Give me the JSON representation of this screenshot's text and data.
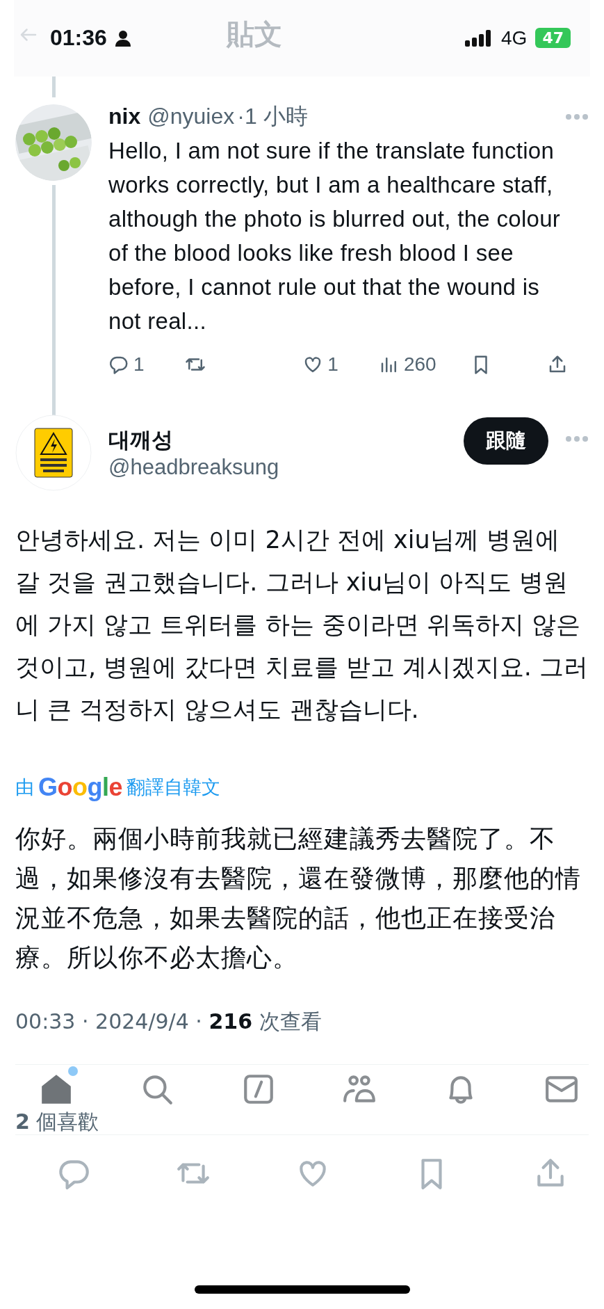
{
  "status_bar": {
    "time": "01:36",
    "network": "4G",
    "battery": "47"
  },
  "header": {
    "title": "貼文"
  },
  "reply": {
    "name": "nix",
    "handle": "@nyuiex",
    "time": "·1 小時",
    "text": "Hello, I am not sure if the translate function works correctly, but I am a healthcare staff, although the photo is blurred out, the colour of the blood looks like fresh blood I see before, I cannot rule out that the wound is not real...",
    "actions": [
      {
        "kind": "reply",
        "count": "1"
      },
      {
        "kind": "repost"
      },
      {
        "kind": "like",
        "count": "1"
      },
      {
        "kind": "views",
        "count": "260"
      },
      {
        "kind": "bookmark"
      },
      {
        "kind": "share"
      }
    ]
  },
  "tweet": {
    "name": "대깨성",
    "handle": "@headbreaksung",
    "follow_button": "跟隨",
    "text": "안녕하세요. 저는 이미 2시간 전에 xiu님께 병원에 갈 것을 권고했습니다. 그러나 xiu님이 아직도 병원에 가지 않고 트위터를 하는 중이라면 위독하지 않은 것이고, 병원에 갔다면 치료를 받고 계시겠지요. 그러니 큰 걱정하지 않으셔도 괜찮습니다.",
    "translation": {
      "by": "由",
      "brand": "Google",
      "label": "翻譯自韓文"
    },
    "translated_text": "你好。兩個小時前我就已經建議秀去醫院了。不過，如果修沒有去醫院，還在發微博，那麼他的情況並不危急，如果去醫院的話，他也正在接受治療。所以你不必太擔心。",
    "meta": "00:33 · 2024/9/4 · **216** 次查看",
    "likes": "**2** 個喜歡"
  },
  "tab_bar": [
    {
      "kind": "home",
      "selected": true,
      "badge": true
    },
    {
      "kind": "search",
      "selected": false
    },
    {
      "kind": "grok",
      "selected": false
    },
    {
      "kind": "communities",
      "selected": false
    },
    {
      "kind": "notifications",
      "selected": false
    },
    {
      "kind": "messages",
      "selected": false
    }
  ],
  "action_bar": [
    {
      "kind": "reply"
    },
    {
      "kind": "repost"
    },
    {
      "kind": "like"
    },
    {
      "kind": "bookmark"
    },
    {
      "kind": "share"
    }
  ]
}
